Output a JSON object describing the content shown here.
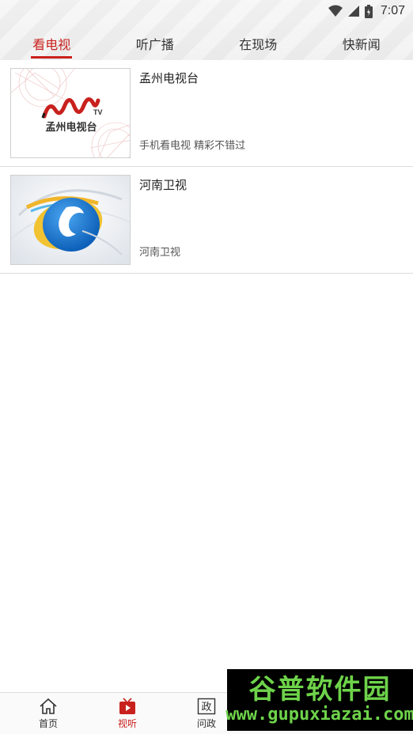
{
  "status_bar": {
    "time": "7:07",
    "icons": [
      "wifi-icon",
      "signal-icon",
      "battery-icon"
    ]
  },
  "tabs": [
    {
      "label": "看电视",
      "active": true
    },
    {
      "label": "听广播",
      "active": false
    },
    {
      "label": "在现场",
      "active": false
    },
    {
      "label": "快新闻",
      "active": false
    }
  ],
  "channels": [
    {
      "title": "孟州电视台",
      "description": "手机看电视  精彩不错过",
      "logo_text": "孟州电视台",
      "logo_mark": "TV"
    },
    {
      "title": "河南卫视",
      "description": "河南卫视"
    }
  ],
  "bottom_nav": [
    {
      "label": "首页",
      "icon": "home-icon",
      "active": false
    },
    {
      "label": "视听",
      "icon": "tv-play-icon",
      "active": true
    },
    {
      "label": "问政",
      "icon": "politics-icon",
      "icon_char": "政",
      "active": false
    }
  ],
  "watermark": {
    "title": "谷普软件园",
    "url": "www.gupuxiazai.com"
  },
  "colors": {
    "accent": "#c8211d",
    "divider": "#dcdcdc",
    "watermark": "#6ed34a"
  }
}
